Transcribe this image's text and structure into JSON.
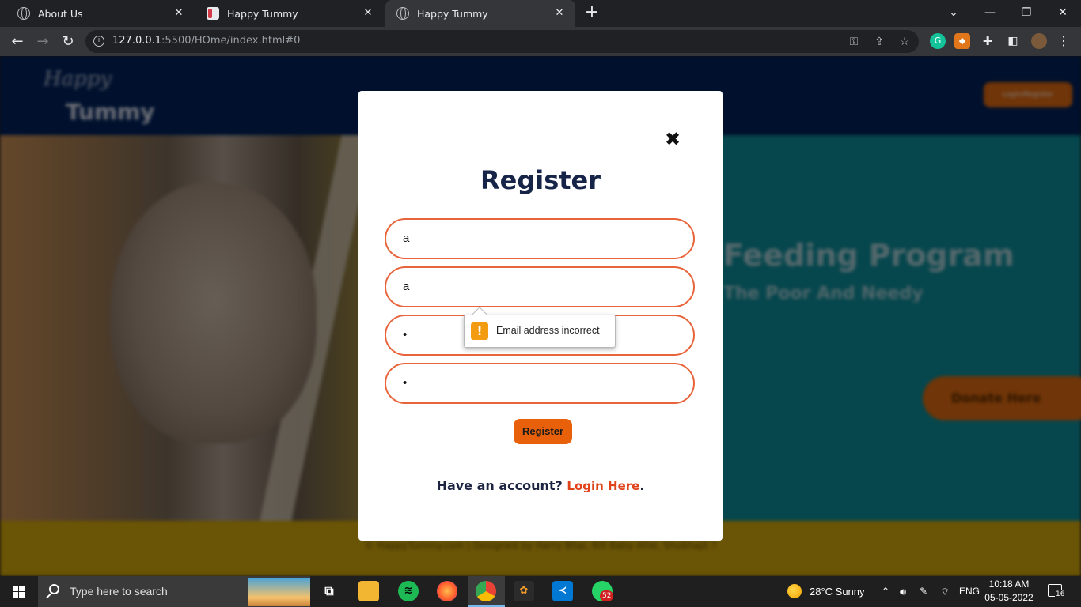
{
  "browser": {
    "tabs": [
      {
        "title": "About Us",
        "active": false
      },
      {
        "title": "Happy Tummy",
        "active": false
      },
      {
        "title": "Happy Tummy",
        "active": true
      }
    ],
    "url_host": "127.0.0.1",
    "url_path": ":5500/HOme/index.html#0"
  },
  "site": {
    "logo_line1": "Happy",
    "logo_line2": "Tummy",
    "header_button": "Login/Register",
    "hero_title": "Feeding Program",
    "hero_subtitle": "The Poor And Needy",
    "donate_button": "Donate Here",
    "footer_text": "© HappyTummy.com | Designed by Harry Bhai, Rill Baby Ahle, Shubhajit ?"
  },
  "modal": {
    "title": "Register",
    "close_symbol": "✖",
    "fields": [
      {
        "value": "a"
      },
      {
        "value": "a"
      },
      {
        "value": "•"
      },
      {
        "value": "•"
      }
    ],
    "submit_label": "Register",
    "account_prompt": "Have an account?",
    "login_link": "Login Here",
    "period": ".",
    "validation_message": "Email address incorrect"
  },
  "taskbar": {
    "search_placeholder": "Type here to search",
    "whatsapp_badge": "52",
    "weather": "28°C  Sunny",
    "language": "ENG",
    "time": "10:18 AM",
    "date": "05-05-2022",
    "notification_count": "16"
  },
  "colors": {
    "accent_orange": "#e8600a",
    "field_border": "#e8643a",
    "title_navy": "#162447",
    "link_red": "#e0421a"
  }
}
